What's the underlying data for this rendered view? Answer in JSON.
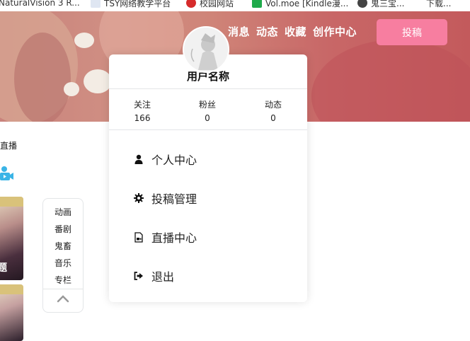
{
  "bookmarks": [
    {
      "label": "NaturalVision 3 R...",
      "icon": "doc-icon"
    },
    {
      "label": "TSY网络教学平台",
      "icon": "page-icon"
    },
    {
      "label": "校园网站",
      "icon": "site-icon"
    },
    {
      "label": "Vol.moe [Kindle漫...",
      "icon": "grid-icon"
    },
    {
      "label": "鬼三宝...",
      "icon": "person-icon"
    },
    {
      "label": "下载...",
      "icon": "page-icon"
    }
  ],
  "nav": {
    "messages": "消息",
    "dynamics": "动态",
    "favorites": "收藏",
    "creator_center": "创作中心",
    "submit": "投稿"
  },
  "profile": {
    "username": "用户名称",
    "stats": [
      {
        "label": "关注",
        "value": "166"
      },
      {
        "label": "粉丝",
        "value": "0"
      },
      {
        "label": "动态",
        "value": "0"
      }
    ],
    "menu": [
      {
        "label": "个人中心",
        "icon": "user-icon"
      },
      {
        "label": "投稿管理",
        "icon": "gear-icon"
      },
      {
        "label": "直播中心",
        "icon": "video-file-icon"
      },
      {
        "label": "退出",
        "icon": "sign-out-icon"
      }
    ]
  },
  "left": {
    "live_label": "直播",
    "thumb1_caption": "题"
  },
  "categories": {
    "items": [
      "动画",
      "番剧",
      "鬼畜",
      "音乐",
      "专栏"
    ],
    "up_icon": "chevron-up-icon"
  },
  "colors": {
    "accent": "#f77ea0",
    "banner": "#c86767",
    "camera": "#3ab4e6"
  }
}
